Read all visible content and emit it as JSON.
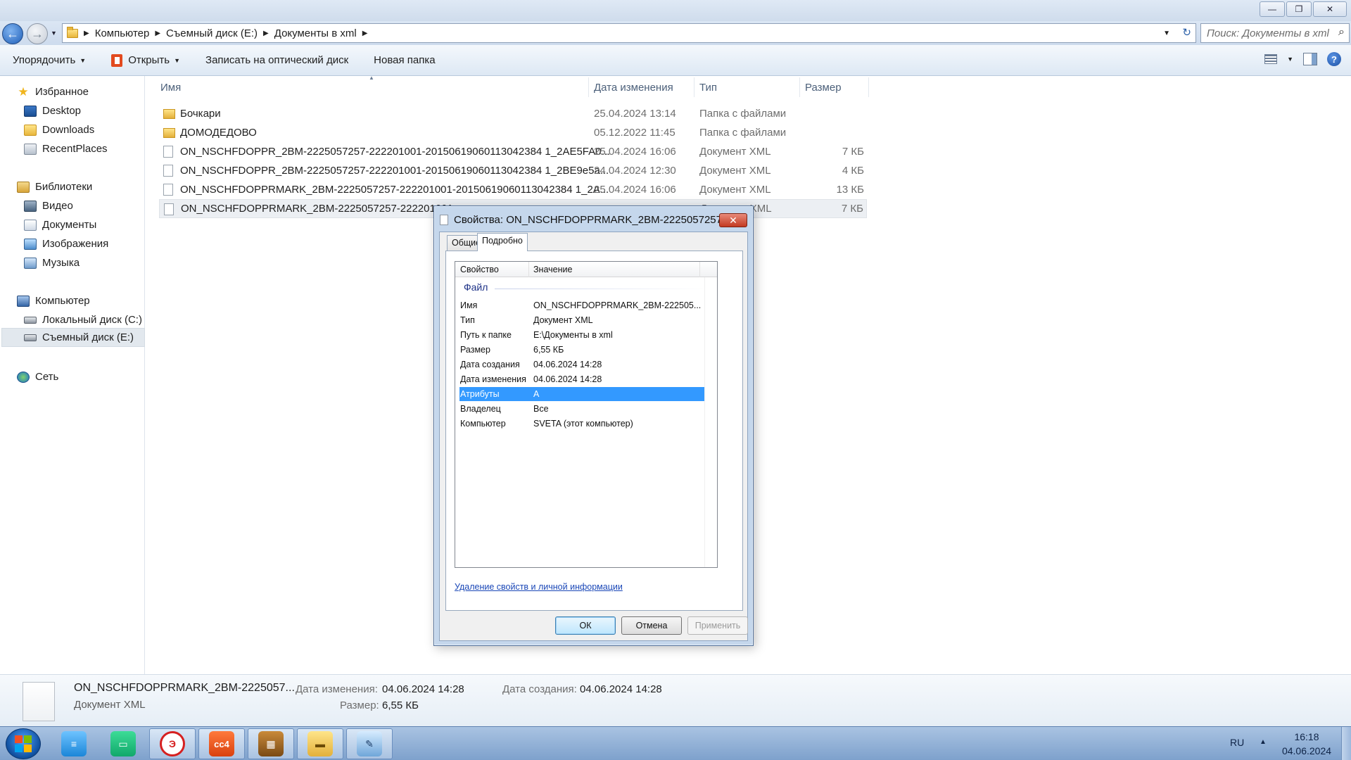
{
  "window": {
    "minimize": "—",
    "maximize": "❐",
    "close": "✕"
  },
  "address": {
    "crumbs": [
      "Компьютер",
      "Съемный диск (E:)",
      "Документы в xml"
    ],
    "search_placeholder": "Поиск: Документы в xml"
  },
  "toolbar": {
    "organize": "Упорядочить",
    "open": "Открыть",
    "burn": "Записать на оптический диск",
    "new_folder": "Новая папка"
  },
  "sidebar": {
    "favorites": "Избранное",
    "fav_items": [
      "Desktop",
      "Downloads",
      "RecentPlaces"
    ],
    "libraries": "Библиотеки",
    "lib_items": [
      "Видео",
      "Документы",
      "Изображения",
      "Музыка"
    ],
    "computer": "Компьютер",
    "drives": [
      "Локальный диск (C:)",
      "Съемный диск (E:)"
    ],
    "network": "Сеть"
  },
  "columns": {
    "name": "Имя",
    "date": "Дата изменения",
    "type": "Тип",
    "size": "Размер"
  },
  "files": [
    {
      "name": "Бочкари",
      "date": "25.04.2024 13:14",
      "type": "Папка с файлами",
      "size": "",
      "kind": "folder"
    },
    {
      "name": "ДОМОДЕДОВО",
      "date": "05.12.2022 11:45",
      "type": "Папка с файлами",
      "size": "",
      "kind": "folder"
    },
    {
      "name": "ON_NSCHFDOPPR_2BM-2225057257-222201001-20150619060113042384 1_2AE5FA0...",
      "date": "25.04.2024 16:06",
      "type": "Документ XML",
      "size": "7 КБ",
      "kind": "doc"
    },
    {
      "name": "ON_NSCHFDOPPR_2BM-2225057257-222201001-20150619060113042384 1_2BE9e5a...",
      "date": "24.04.2024 12:30",
      "type": "Документ XML",
      "size": "4 КБ",
      "kind": "doc"
    },
    {
      "name": "ON_NSCHFDOPPRMARK_2BM-2225057257-222201001-20150619060113042384 1_2A...",
      "date": "25.04.2024 16:06",
      "type": "Документ XML",
      "size": "13 КБ",
      "kind": "doc"
    },
    {
      "name": "ON_NSCHFDOPPRMARK_2BM-2225057257-222201001",
      "date": "",
      "type": "Документ XML",
      "size": "7 КБ",
      "kind": "doc"
    }
  ],
  "details": {
    "name": "ON_NSCHFDOPPRMARK_2BM-2225057...",
    "type": "Документ XML",
    "modified_label": "Дата изменения:",
    "modified_value": "04.06.2024 14:28",
    "created_label": "Дата создания:",
    "created_value": "04.06.2024 14:28",
    "size_label": "Размер:",
    "size_value": "6,55 КБ"
  },
  "dialog": {
    "title": "Свойства: ON_NSCHFDOPPRMARK_2BM-2225057257...",
    "close": "✕",
    "tab_general": "Общие",
    "tab_details": "Подробно",
    "col_property": "Свойство",
    "col_value": "Значение",
    "group": "Файл",
    "props": [
      {
        "k": "Имя",
        "v": "ON_NSCHFDOPPRMARK_2BM-222505..."
      },
      {
        "k": "Тип",
        "v": "Документ XML"
      },
      {
        "k": "Путь к папке",
        "v": "E:\\Документы в xml"
      },
      {
        "k": "Размер",
        "v": "6,55 КБ"
      },
      {
        "k": "Дата создания",
        "v": "04.06.2024 14:28"
      },
      {
        "k": "Дата изменения",
        "v": "04.06.2024 14:28"
      },
      {
        "k": "Атрибуты",
        "v": "A"
      },
      {
        "k": "Владелец",
        "v": "Все"
      },
      {
        "k": "Компьютер",
        "v": "SVETA (этот компьютер)"
      }
    ],
    "selected_prop": "Атрибуты",
    "link": "Удаление свойств и личной информации",
    "ok": "ОК",
    "cancel": "Отмена",
    "apply": "Применить"
  },
  "taskbar": {
    "apps": [
      "notes",
      "messenger",
      "kontur",
      "cc4",
      "calculator",
      "explorer",
      "notepad"
    ],
    "lang": "RU",
    "time": "16:18",
    "date": "04.06.2024"
  }
}
